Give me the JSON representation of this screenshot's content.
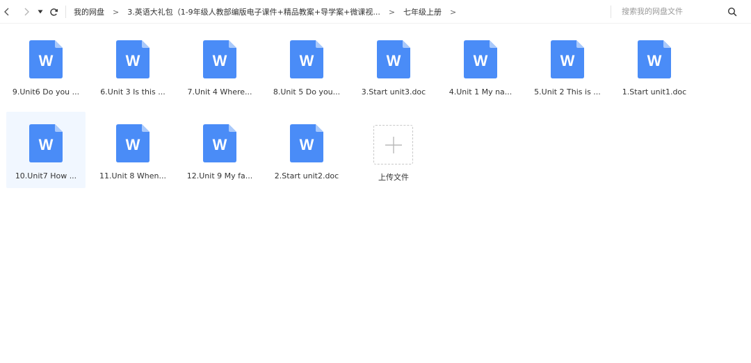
{
  "toolbar": {
    "back_icon": "chevron-left-icon",
    "forward_icon": "chevron-right-icon",
    "history_icon": "caret-down-icon",
    "refresh_icon": "refresh-icon",
    "breadcrumb": [
      "我的网盘",
      "3.英语大礼包（1-9年级人教部编版电子课件+精品教案+导学案+微课视...",
      "七年级上册"
    ],
    "breadcrumb_separator": ">",
    "search_placeholder": "搜索我的网盘文件",
    "search_icon": "search-icon"
  },
  "colors": {
    "doc_icon_blue": "#4a8cf7",
    "doc_icon_fold": "#a9c9fb",
    "selected_bg": "#f1f7ff"
  },
  "files": [
    {
      "name": "9.Unit6 Do you ...",
      "icon": "word-doc-icon",
      "letter": "W"
    },
    {
      "name": "6.Unit 3 Is this ...",
      "icon": "word-doc-icon",
      "letter": "W"
    },
    {
      "name": "7.Unit 4 Where...",
      "icon": "word-doc-icon",
      "letter": "W"
    },
    {
      "name": "8.Unit 5 Do you...",
      "icon": "word-doc-icon",
      "letter": "W"
    },
    {
      "name": "3.Start unit3.doc",
      "icon": "word-doc-icon",
      "letter": "W"
    },
    {
      "name": "4.Unit 1 My na...",
      "icon": "word-doc-icon",
      "letter": "W"
    },
    {
      "name": "5.Unit 2 This is ...",
      "icon": "word-doc-icon",
      "letter": "W"
    },
    {
      "name": "1.Start unit1.doc",
      "icon": "word-doc-icon",
      "letter": "W"
    },
    {
      "name": "10.Unit7 How ...",
      "icon": "word-doc-icon",
      "letter": "W",
      "selected": true
    },
    {
      "name": "11.Unit 8 When...",
      "icon": "word-doc-icon",
      "letter": "W"
    },
    {
      "name": "12.Unit 9 My fa...",
      "icon": "word-doc-icon",
      "letter": "W"
    },
    {
      "name": "2.Start unit2.doc",
      "icon": "word-doc-icon",
      "letter": "W"
    }
  ],
  "upload": {
    "label": "上传文件",
    "icon": "plus-icon"
  }
}
